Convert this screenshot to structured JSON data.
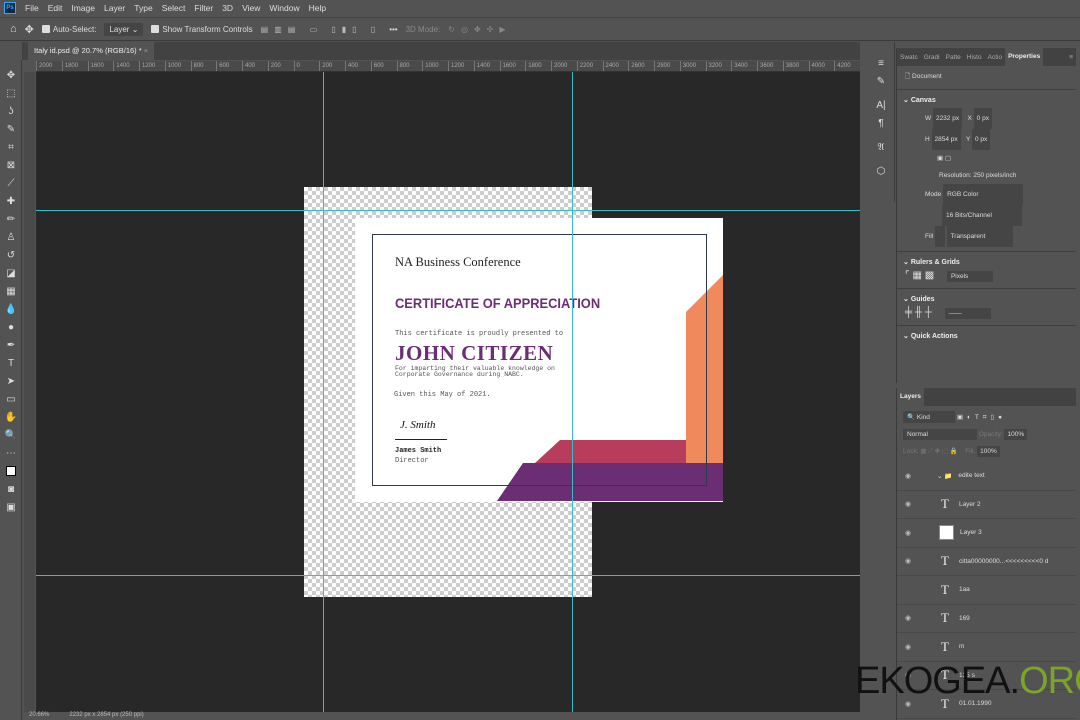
{
  "menu": {
    "items": [
      "File",
      "Edit",
      "Image",
      "Layer",
      "Type",
      "Select",
      "Filter",
      "3D",
      "View",
      "Window",
      "Help"
    ]
  },
  "options": {
    "auto_select": "Auto-Select:",
    "layer_select": "Layer",
    "transform": "Show Transform Controls",
    "mode_3d": "3D Mode:"
  },
  "tab": {
    "title": "Italy id.psd @ 20.7% (RGB/16) *"
  },
  "ruler": {
    "labels": [
      "2000",
      "1800",
      "1600",
      "1400",
      "1200",
      "1000",
      "800",
      "600",
      "400",
      "200",
      "0",
      "200",
      "400",
      "600",
      "800",
      "1000",
      "1200",
      "1400",
      "1600",
      "1800",
      "2000",
      "2200",
      "2400",
      "2600",
      "2800",
      "3000",
      "3200",
      "3400",
      "3600",
      "3800",
      "4000",
      "4200"
    ]
  },
  "certificate": {
    "org": "NA Business Conference",
    "title": "CERTIFICATE OF APPRECIATION",
    "presented": "This certificate is proudly presented to",
    "name": "JOHN CITIZEN",
    "reason1": "For imparting their valuable knowledge on",
    "reason2": "Corporate Governance during NABC.",
    "given": "Given this May of 2021.",
    "signature": "J. Smith",
    "signer": "James Smith",
    "role": "Director",
    "colors": {
      "purple": "#6b2d73",
      "pink": "#b83c5c",
      "orange": "#f08a5d"
    }
  },
  "status": {
    "zoom": "20.66%",
    "doc": "2232 px x 2854 px (250 ppi)"
  },
  "properties": {
    "tabs": [
      "Swatc",
      "Gradi",
      "Patte",
      "Histo",
      "Actio",
      "Properties"
    ],
    "doc_label": "Document",
    "canvas": "Canvas",
    "w_label": "W",
    "w": "2232 px",
    "h_label": "H",
    "h": "2854 px",
    "x_label": "X",
    "y_label": "Y",
    "x": "0 px",
    "y": "0 px",
    "resolution": "Resolution: 250 pixels/inch",
    "mode_label": "Mode",
    "mode": "RGB Color",
    "depth": "16 Bits/Channel",
    "fill_label": "Fill",
    "fill": "Transparent",
    "rulers": "Rulers & Grids",
    "units": "Pixels",
    "guides": "Guides",
    "quick": "Quick Actions"
  },
  "layers": {
    "title": "Layers",
    "kind": "Kind",
    "blend": "Normal",
    "opacity_label": "Opacity:",
    "opacity": "100%",
    "lock_label": "Lock:",
    "fill_label": "Fill:",
    "fill": "100%",
    "items": [
      {
        "name": "edite text",
        "type": "group"
      },
      {
        "name": "Layer 2",
        "type": "text"
      },
      {
        "name": "Layer 3",
        "type": "image"
      },
      {
        "name": "citta00000000...<<<<<<<<<0 d",
        "type": "text"
      },
      {
        "name": "1aa",
        "type": "text"
      },
      {
        "name": "169",
        "type": "text"
      },
      {
        "name": "m",
        "type": "text"
      },
      {
        "name": "125 s",
        "type": "text"
      },
      {
        "name": "01.01.1990",
        "type": "text"
      }
    ]
  },
  "watermark": {
    "text1": "EKOGEA.",
    "text2": "ORG"
  }
}
